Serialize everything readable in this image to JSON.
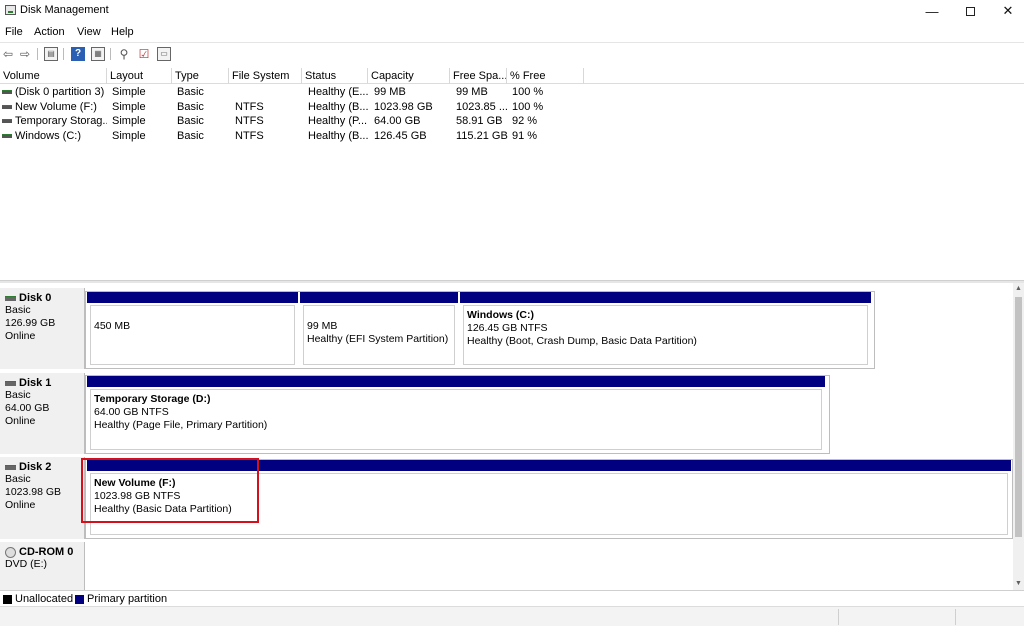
{
  "window": {
    "title": "Disk Management",
    "minimize": "—",
    "close": "✕"
  },
  "menu": [
    "File",
    "Action",
    "View",
    "Help"
  ],
  "toolbar": {
    "icons": [
      "back-arrow-icon",
      "forward-arrow-icon",
      "volume-list-icon",
      "help-icon",
      "properties-icon",
      "connect-icon",
      "check-icon",
      "console-icon"
    ],
    "help_glyph": "?"
  },
  "volume_list": {
    "columns": [
      "Volume",
      "Layout",
      "Type",
      "File System",
      "Status",
      "Capacity",
      "Free Spa...",
      "% Free"
    ],
    "rows": [
      {
        "volume": "(Disk 0 partition 3)",
        "layout": "Simple",
        "type": "Basic",
        "fs": "",
        "status": "Healthy (E...",
        "capacity": "99 MB",
        "free": "99 MB",
        "pct": "100 %"
      },
      {
        "volume": "New Volume (F:)",
        "layout": "Simple",
        "type": "Basic",
        "fs": "NTFS",
        "status": "Healthy (B...",
        "capacity": "1023.98 GB",
        "free": "1023.85 ...",
        "pct": "100 %"
      },
      {
        "volume": "Temporary Storag...",
        "layout": "Simple",
        "type": "Basic",
        "fs": "NTFS",
        "status": "Healthy (P...",
        "capacity": "64.00 GB",
        "free": "58.91 GB",
        "pct": "92 %"
      },
      {
        "volume": "Windows (C:)",
        "layout": "Simple",
        "type": "Basic",
        "fs": "NTFS",
        "status": "Healthy (B...",
        "capacity": "126.45 GB",
        "free": "115.21 GB",
        "pct": "91 %"
      }
    ]
  },
  "disks": [
    {
      "name": "Disk 0",
      "type": "Basic",
      "size": "126.99 GB",
      "state": "Online",
      "partitions": [
        {
          "name": "",
          "size_fs": "450 MB",
          "status": ""
        },
        {
          "name": "",
          "size_fs": "99 MB",
          "status": "Healthy (EFI System Partition)"
        },
        {
          "name": "Windows  (C:)",
          "size_fs": "126.45 GB NTFS",
          "status": "Healthy (Boot, Crash Dump, Basic Data Partition)"
        }
      ]
    },
    {
      "name": "Disk 1",
      "type": "Basic",
      "size": "64.00 GB",
      "state": "Online",
      "partitions": [
        {
          "name": "Temporary Storage  (D:)",
          "size_fs": "64.00 GB NTFS",
          "status": "Healthy (Page File, Primary Partition)"
        }
      ]
    },
    {
      "name": "Disk 2",
      "type": "Basic",
      "size": "1023.98 GB",
      "state": "Online",
      "partitions": [
        {
          "name": "New Volume  (F:)",
          "size_fs": "1023.98 GB NTFS",
          "status": "Healthy (Basic Data Partition)"
        }
      ]
    },
    {
      "name": "CD-ROM 0",
      "type": "DVD (E:)",
      "size": "",
      "state": ""
    }
  ],
  "legend": [
    {
      "label": "Unallocated",
      "color": "#000000"
    },
    {
      "label": "Primary partition",
      "color": "#000080"
    }
  ],
  "colors": {
    "primary_partition": "#000080",
    "highlight": "#d6101a"
  }
}
